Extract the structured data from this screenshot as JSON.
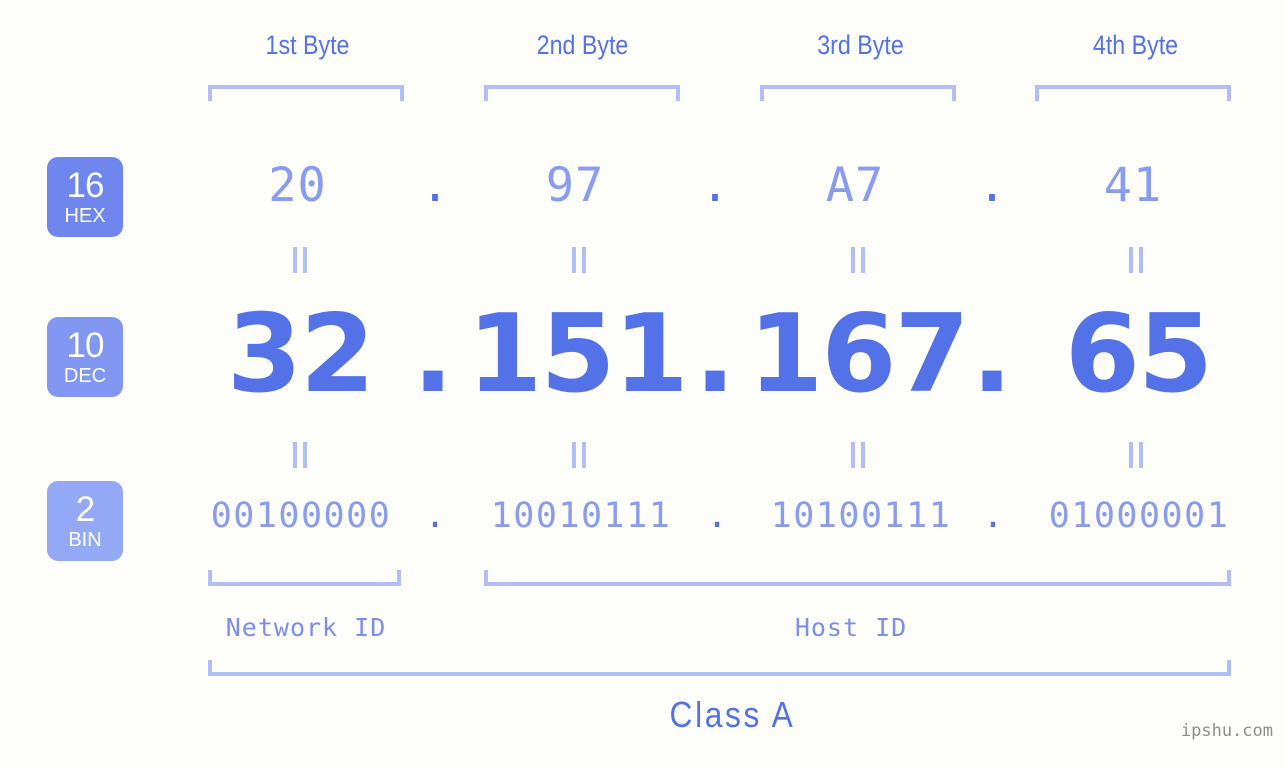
{
  "page": {
    "background": "#fdfdfa",
    "accent_dark": "#5472e8",
    "accent_light": "#8a9cf0",
    "accent_bracket": "#b3bdf7",
    "watermark": "ipshu.com"
  },
  "byte_headers": [
    {
      "label": "1st Byte"
    },
    {
      "label": "2nd Byte"
    },
    {
      "label": "3rd Byte"
    },
    {
      "label": "4th Byte"
    }
  ],
  "bases": [
    {
      "num": "16",
      "label": "HEX",
      "color": "#6f86ee"
    },
    {
      "num": "10",
      "label": "DEC",
      "color": "#8297f2"
    },
    {
      "num": "2",
      "label": "BIN",
      "color": "#93a9f5"
    }
  ],
  "rows": {
    "hex": {
      "values": [
        "20",
        "97",
        "A7",
        "41"
      ],
      "separator": "."
    },
    "dec": {
      "values": [
        "32",
        "151",
        "167",
        "65"
      ],
      "separator": "."
    },
    "bin": {
      "values": [
        "00100000",
        "10010111",
        "10100111",
        "01000001"
      ],
      "separator": "."
    }
  },
  "equals_symbol": "=",
  "sections": {
    "network_id": "Network ID",
    "host_id": "Host ID",
    "class": "Class A"
  },
  "ip_address": {
    "dec": "32.151.167.65",
    "hex": "20.97.A7.41",
    "bin": "00100000.10010111.10100111.01000001"
  }
}
